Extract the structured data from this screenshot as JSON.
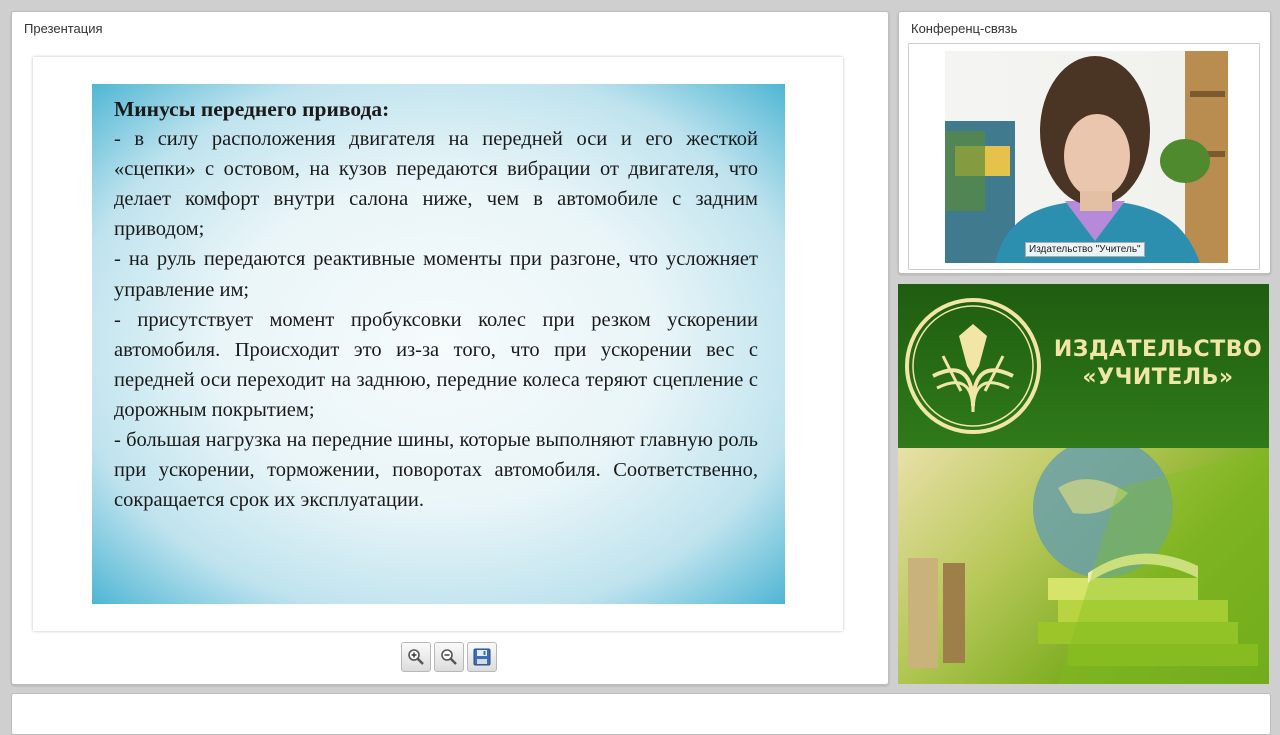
{
  "presentation": {
    "title": "Презентация",
    "slide": {
      "heading": "Минусы переднего привода:",
      "paragraphs": [
        "- в силу расположения двигателя на передней оси и его жесткой «сцепки» с остовом, на кузов передаются вибрации от двигателя, что делает комфорт внутри салона ниже, чем в автомобиле с задним приводом;",
        "- на руль передаются реактивные моменты при разгоне, что усложняет управление им;",
        "- присутствует момент пробуксовки колес при резком ускорении автомобиля. Происходит это из-за того, что при ускорении вес с передней оси переходит на заднюю, передние колеса теряют сцепление с дорожным покрытием;",
        "- большая нагрузка на передние шины, которые выполняют главную роль при ускорении, торможении, поворотах автомобиля. Соответственно, сокращается срок их эксплуатации."
      ]
    },
    "toolbar": {
      "zoom_in_icon": "zoom-in-icon",
      "zoom_out_icon": "zoom-out-icon",
      "save_icon": "save-icon"
    }
  },
  "conference": {
    "title": "Конференц-связь",
    "participant_name": "Издательство \"Учитель\""
  },
  "publisher_logo": {
    "line1": "ИЗДАТЕЛЬСТВО",
    "line2": "«УЧИТЕЛЬ»",
    "colors": {
      "green": "#2f7a1a",
      "gold": "#f1e6a6"
    }
  }
}
